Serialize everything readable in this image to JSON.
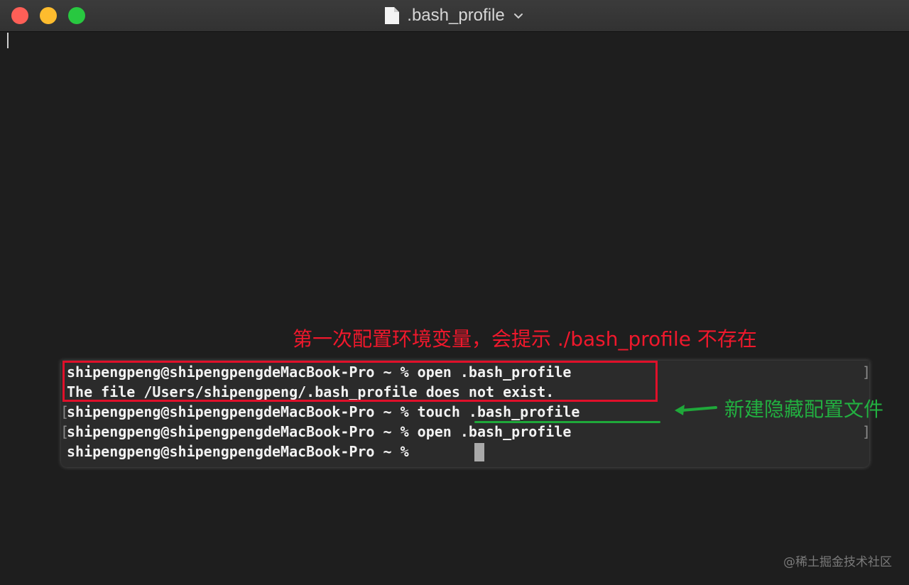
{
  "window": {
    "title": ".bash_profile",
    "icons": {
      "close": "close-icon",
      "minimize": "minimize-icon",
      "zoom": "zoom-icon",
      "document": "document-icon",
      "chevron": "chevron-down-icon"
    },
    "colors": {
      "close": "#fe5f57",
      "minimize": "#febc2e",
      "zoom": "#28c840",
      "background": "#1e1e1e"
    }
  },
  "terminal": {
    "lines": [
      "shipengpeng@shipengpengdeMacBook-Pro ~ % open .bash_profile",
      "The file /Users/shipengpeng/.bash_profile does not exist.",
      "shipengpeng@shipengpengdeMacBook-Pro ~ % touch .bash_profile",
      "shipengpeng@shipengpengdeMacBook-Pro ~ % open .bash_profile",
      "shipengpeng@shipengpengdeMacBook-Pro ~ % "
    ]
  },
  "annotations": {
    "red_caption": "第一次配置环境变量，会提示 ./bash_profile 不存在",
    "green_caption": "新建隐藏配置文件",
    "red_color": "#e0102a",
    "green_color": "#1fa83a"
  },
  "watermark": "@稀土掘金技术社区"
}
